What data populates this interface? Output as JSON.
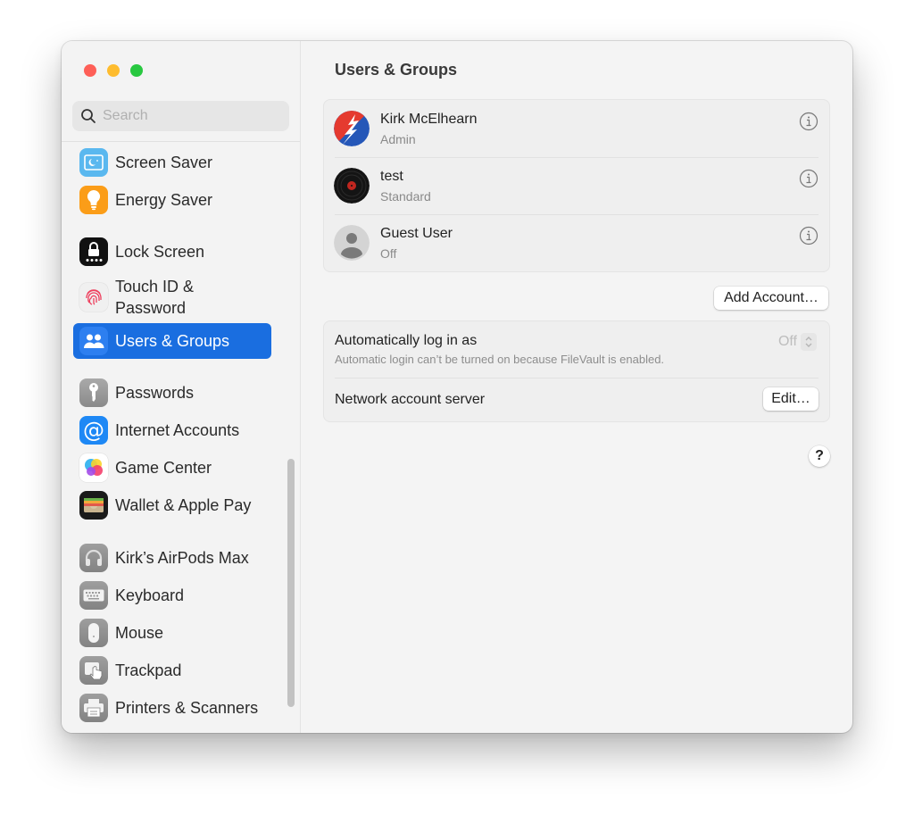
{
  "window": {
    "title": "Users & Groups",
    "traffic_lights": [
      "close",
      "minimize",
      "zoom"
    ]
  },
  "sidebar": {
    "search": {
      "placeholder": "Search",
      "value": ""
    },
    "items": [
      {
        "label": "Screen Saver",
        "icon": "screen-saver-icon",
        "color": "#5ab8ef"
      },
      {
        "label": "Energy Saver",
        "icon": "lightbulb-icon",
        "color": "#fb9d18"
      },
      {
        "label": "Lock Screen",
        "icon": "lock-icon",
        "color": "#111111"
      },
      {
        "label": "Touch ID & Password",
        "icon": "fingerprint-icon",
        "color": "#f0f0f0"
      },
      {
        "label": "Users & Groups",
        "icon": "users-icon",
        "color": "#2d7ff0",
        "selected": true
      },
      {
        "label": "Passwords",
        "icon": "key-icon",
        "color": "#9a9a9a"
      },
      {
        "label": "Internet Accounts",
        "icon": "at-sign-icon",
        "color": "#1e88f5"
      },
      {
        "label": "Game Center",
        "icon": "game-center-icon",
        "color": "#ffffff"
      },
      {
        "label": "Wallet & Apple Pay",
        "icon": "wallet-icon",
        "color": "#1a1a1a"
      },
      {
        "label": "Kirk’s AirPods Max",
        "icon": "headphones-icon",
        "color": "#8e8e8e"
      },
      {
        "label": "Keyboard",
        "icon": "keyboard-icon",
        "color": "#8e8e8e"
      },
      {
        "label": "Mouse",
        "icon": "mouse-icon",
        "color": "#8e8e8e"
      },
      {
        "label": "Trackpad",
        "icon": "trackpad-icon",
        "color": "#8e8e8e"
      },
      {
        "label": "Printers & Scanners",
        "icon": "printer-icon",
        "color": "#8e8e8e"
      }
    ],
    "selected_color": "#1a6ee0"
  },
  "main": {
    "title": "Users & Groups",
    "users": [
      {
        "name": "Kirk McElhearn",
        "role": "Admin",
        "avatar": "steal-your-face-avatar"
      },
      {
        "name": "test",
        "role": "Standard",
        "avatar": "vinyl-record-avatar"
      },
      {
        "name": "Guest User",
        "role": "Off",
        "avatar": "generic-person-avatar"
      }
    ],
    "add_account_label": "Add Account…",
    "auto_login": {
      "label": "Automatically log in as",
      "sublabel": "Automatic login can’t be turned on because FileVault is enabled.",
      "value": "Off"
    },
    "network_server": {
      "label": "Network account server",
      "button": "Edit…"
    },
    "help_label": "?"
  }
}
